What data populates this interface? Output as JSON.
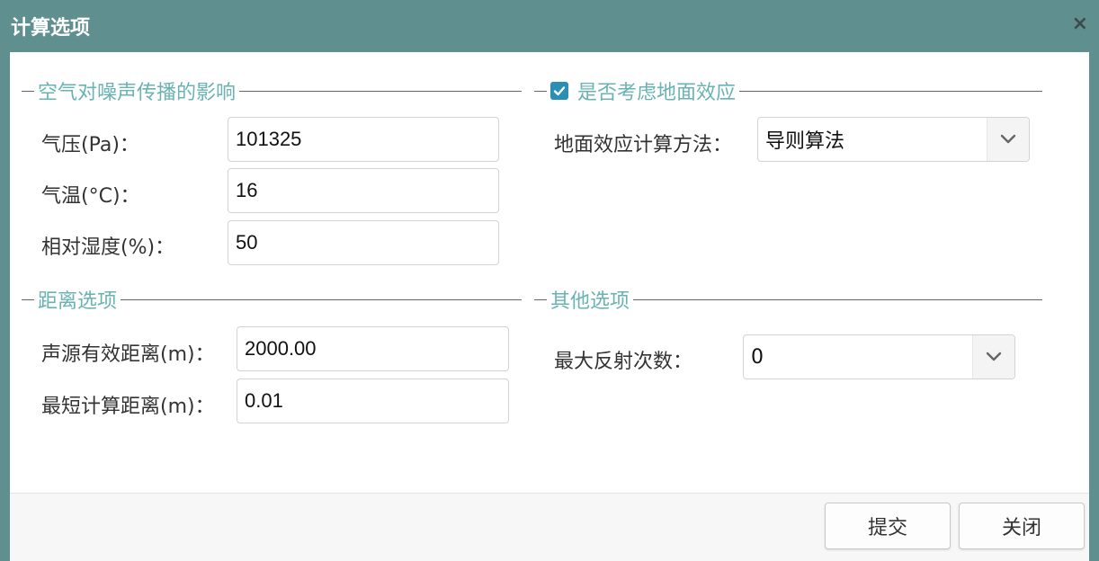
{
  "dialog": {
    "title": "计算选项",
    "close": "×"
  },
  "air": {
    "legend": "空气对噪声传播的影响",
    "pressure_label": "气压(Pa)：",
    "pressure_value": "101325",
    "temperature_label": "气温(°C)：",
    "temperature_value": "16",
    "humidity_label": "相对湿度(%)：",
    "humidity_value": "50"
  },
  "ground": {
    "legend": "是否考虑地面效应",
    "checked": true,
    "method_label": "地面效应计算方法：",
    "method_value": "导则算法"
  },
  "distance": {
    "legend": "距离选项",
    "source_label": "声源有效距离(m)：",
    "source_value": "2000.00",
    "min_label": "最短计算距离(m)：",
    "min_value": "0.01"
  },
  "other": {
    "legend": "其他选项",
    "reflections_label": "最大反射次数：",
    "reflections_value": "0"
  },
  "buttons": {
    "submit": "提交",
    "close": "关闭"
  },
  "colors": {
    "titlebar": "#5f8f8e",
    "legend": "#69b3b2",
    "checkbox": "#2b8fb5"
  }
}
